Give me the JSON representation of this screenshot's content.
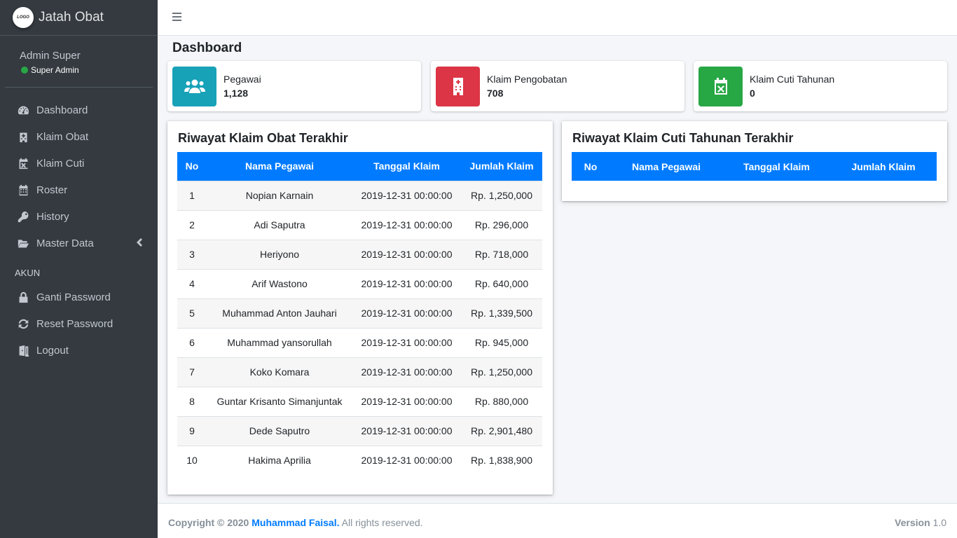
{
  "brand": {
    "logo_text": "LOGO",
    "title": "Jatah Obat"
  },
  "user": {
    "name": "Admin Super",
    "role": "Super Admin"
  },
  "sidebar": {
    "items": [
      {
        "label": "Dashboard",
        "icon": "tachometer-icon"
      },
      {
        "label": "Klaim Obat",
        "icon": "hospital-icon"
      },
      {
        "label": "Klaim Cuti",
        "icon": "calendar-times-icon"
      },
      {
        "label": "Roster",
        "icon": "calendar-icon"
      },
      {
        "label": "History",
        "icon": "key-icon"
      },
      {
        "label": "Master Data",
        "icon": "folder-open-icon"
      }
    ],
    "section_header": "AKUN",
    "account_items": [
      {
        "label": "Ganti Password",
        "icon": "lock-icon"
      },
      {
        "label": "Reset Password",
        "icon": "sync-icon"
      },
      {
        "label": "Logout",
        "icon": "door-open-icon"
      }
    ]
  },
  "page": {
    "title": "Dashboard"
  },
  "info_boxes": [
    {
      "label": "Pegawai",
      "value": "1,128",
      "color": "#17a2b8",
      "icon": "users-icon"
    },
    {
      "label": "Klaim Pengobatan",
      "value": "708",
      "color": "#dc3545",
      "icon": "hospital-icon"
    },
    {
      "label": "Klaim Cuti Tahunan",
      "value": "0",
      "color": "#28a745",
      "icon": "calendar-times-icon"
    }
  ],
  "obat_table": {
    "title": "Riwayat Klaim Obat Terakhir",
    "headers": [
      "No",
      "Nama Pegawai",
      "Tanggal Klaim",
      "Jumlah Klaim"
    ],
    "rows": [
      [
        "1",
        "Nopian Karnain",
        "2019-12-31 00:00:00",
        "Rp. 1,250,000"
      ],
      [
        "2",
        "Adi Saputra",
        "2019-12-31 00:00:00",
        "Rp. 296,000"
      ],
      [
        "3",
        "Heriyono",
        "2019-12-31 00:00:00",
        "Rp. 718,000"
      ],
      [
        "4",
        "Arif Wastono",
        "2019-12-31 00:00:00",
        "Rp. 640,000"
      ],
      [
        "5",
        "Muhammad Anton Jauhari",
        "2019-12-31 00:00:00",
        "Rp. 1,339,500"
      ],
      [
        "6",
        "Muhammad yansorullah",
        "2019-12-31 00:00:00",
        "Rp. 945,000"
      ],
      [
        "7",
        "Koko Komara",
        "2019-12-31 00:00:00",
        "Rp. 1,250,000"
      ],
      [
        "8",
        "Guntar Krisanto Simanjuntak",
        "2019-12-31 00:00:00",
        "Rp. 880,000"
      ],
      [
        "9",
        "Dede Saputro",
        "2019-12-31 00:00:00",
        "Rp. 2,901,480"
      ],
      [
        "10",
        "Hakima Aprilia",
        "2019-12-31 00:00:00",
        "Rp. 1,838,900"
      ]
    ]
  },
  "cuti_table": {
    "title": "Riwayat Klaim Cuti Tahunan Terakhir",
    "headers": [
      "No",
      "Nama Pegawai",
      "Tanggal Klaim",
      "Jumlah Klaim"
    ],
    "rows": []
  },
  "footer": {
    "copyright": "Copyright © 2020",
    "author": "Muhammad Faisal.",
    "rights": "All rights reserved.",
    "version_label": "Version",
    "version_value": "1.0"
  },
  "colors": {
    "sidebar_bg": "#343a40",
    "primary": "#007bff",
    "info": "#17a2b8",
    "danger": "#dc3545",
    "success": "#28a745"
  }
}
